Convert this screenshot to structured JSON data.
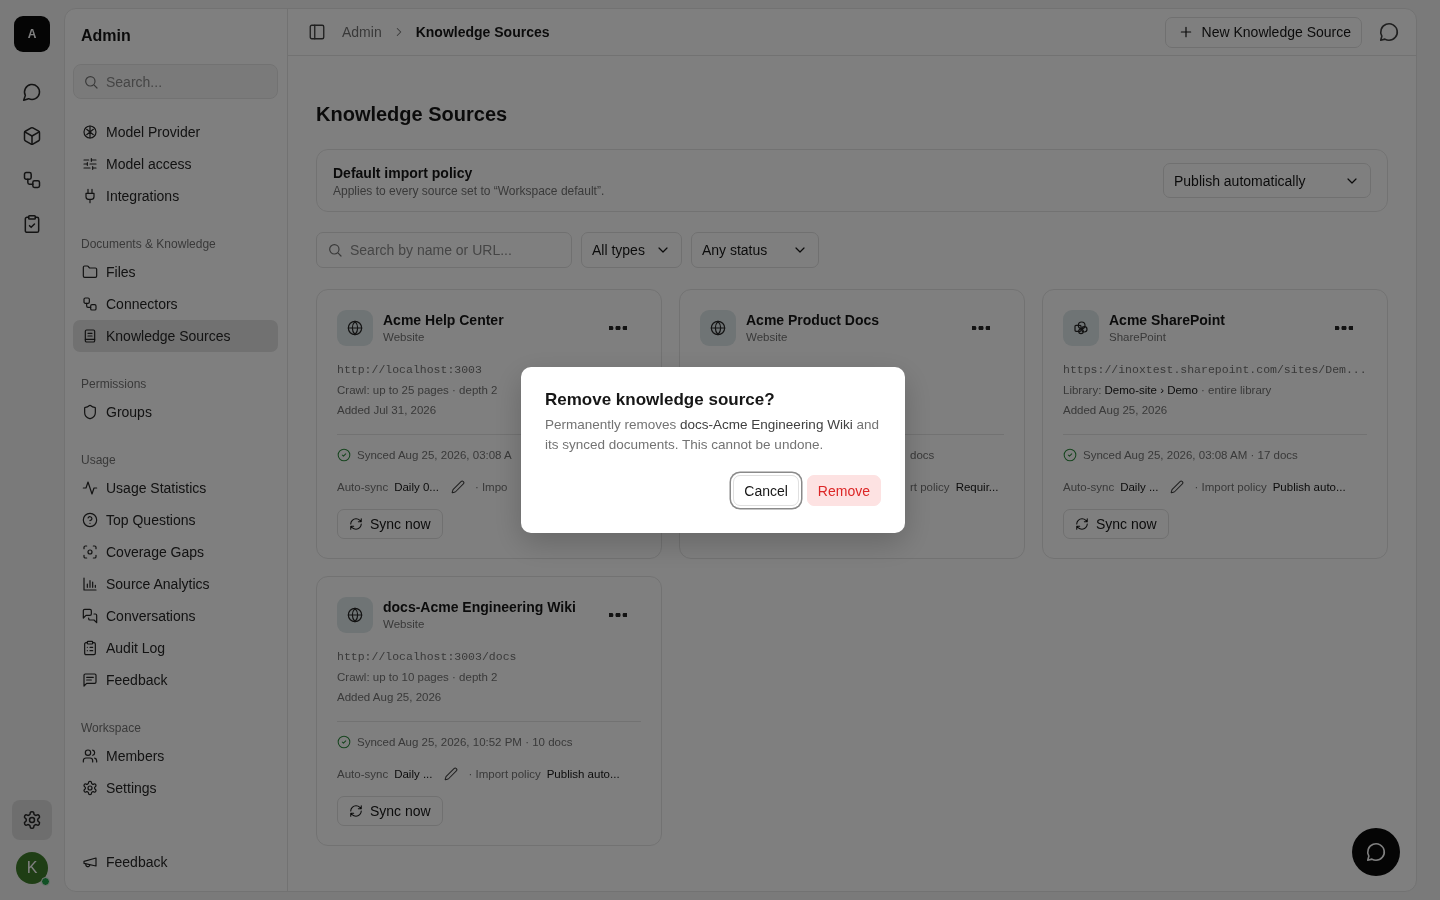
{
  "rail": {
    "logo": "A",
    "items": [
      {
        "selected": false
      },
      {
        "selected": false
      },
      {
        "selected": false
      },
      {
        "selected": false
      }
    ],
    "settings": {
      "selected": true
    },
    "avatar": {
      "initial": "K",
      "online": true
    }
  },
  "sidebar": {
    "title": "Admin",
    "search_placeholder": "Search...",
    "sections": [
      {
        "items": [
          {
            "label": "Model Provider",
            "selected": false
          },
          {
            "label": "Model access",
            "selected": false
          },
          {
            "label": "Integrations",
            "selected": false
          }
        ]
      },
      {
        "heading": "Documents & Knowledge",
        "items": [
          {
            "label": "Files",
            "selected": false
          },
          {
            "label": "Connectors",
            "selected": false
          },
          {
            "label": "Knowledge Sources",
            "selected": true
          }
        ]
      },
      {
        "heading": "Permissions",
        "items": [
          {
            "label": "Groups",
            "selected": false
          }
        ]
      },
      {
        "heading": "Usage",
        "items": [
          {
            "label": "Usage Statistics",
            "selected": false
          },
          {
            "label": "Top Questions",
            "selected": false
          },
          {
            "label": "Coverage Gaps",
            "selected": false
          },
          {
            "label": "Source Analytics",
            "selected": false
          },
          {
            "label": "Conversations",
            "selected": false
          },
          {
            "label": "Audit Log",
            "selected": false
          },
          {
            "label": "Feedback",
            "selected": false
          }
        ]
      },
      {
        "heading": "Workspace",
        "items": [
          {
            "label": "Members",
            "selected": false
          },
          {
            "label": "Settings",
            "selected": false
          }
        ]
      }
    ],
    "footer": {
      "label": "Feedback"
    }
  },
  "topbar": {
    "breadcrumb": [
      "Admin",
      "Knowledge Sources"
    ],
    "new_button": "New Knowledge Source"
  },
  "page_title": "Knowledge Sources",
  "policy": {
    "title": "Default import policy",
    "description": "Applies to every source set to “Workspace default”.",
    "value": "Publish automatically"
  },
  "filters": {
    "search_placeholder": "Search by name or URL...",
    "selects": [
      "All types",
      "Any status"
    ]
  },
  "sources": [
    {
      "kind": "website",
      "name": "Acme Help Center",
      "type": "Website",
      "url": "http://localhost:3003",
      "detail": "Crawl: up to 25 pages · depth 2",
      "added": "Added Jul 31, 2026",
      "sync": "Synced Aug 25, 2026, 03:08 A",
      "autosync_label": "Auto-sync",
      "autosync_value": "Daily 0...",
      "policy_label": "· Impo",
      "button": "Sync now"
    },
    {
      "kind": "website",
      "name": "Acme Product Docs",
      "type": "Website",
      "sync": "docs",
      "policy_label": "rt policy",
      "policy_value": "Requir..."
    },
    {
      "kind": "sharepoint",
      "name": "Acme SharePoint",
      "type": "SharePoint",
      "url": "https://inoxtest.sharepoint.com/sites/Dem...",
      "detail": "Library: **Demo-site › Demo** · entire library",
      "added": "Added Aug 25, 2026",
      "sync": "Synced Aug 25, 2026, 03:08 AM · 17 docs",
      "autosync_label": "Auto-sync",
      "autosync_value": "Daily ...",
      "policy_label": "· Import policy",
      "policy_value": "Publish auto...",
      "button": "Sync now"
    },
    {
      "kind": "website",
      "name": "docs-Acme Engineering Wiki",
      "type": "Website",
      "url": "http://localhost:3003/docs",
      "detail": "Crawl: up to 10 pages · depth 2",
      "added": "Added Aug 25, 2026",
      "sync": "Synced Aug 25, 2026, 10:52 PM · 10 docs",
      "autosync_label": "Auto-sync",
      "autosync_value": "Daily ...",
      "policy_label": "· Import policy",
      "policy_value": "Publish auto...",
      "button": "Sync now"
    }
  ],
  "dialog": {
    "title": "Remove knowledge source?",
    "message": "Permanently removes **docs-Acme Engineering Wiki** and its synced documents. This cannot be undone.",
    "buttons": [
      {
        "label": "Cancel",
        "kind": "secondary",
        "focused": true
      },
      {
        "label": "Remove",
        "kind": "danger",
        "focused": false
      }
    ]
  }
}
